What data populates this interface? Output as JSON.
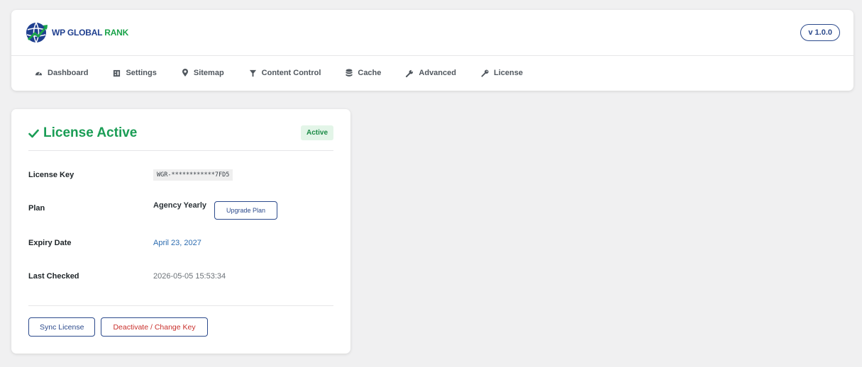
{
  "brand": {
    "name_part1": "WP GLOBAL",
    "name_part2": "RANK",
    "version": "v 1.0.0"
  },
  "nav": [
    {
      "label": "Dashboard",
      "icon": "dashboard-icon"
    },
    {
      "label": "Settings",
      "icon": "settings-icon"
    },
    {
      "label": "Sitemap",
      "icon": "map-pin-icon"
    },
    {
      "label": "Content Control",
      "icon": "filter-icon"
    },
    {
      "label": "Cache",
      "icon": "database-icon"
    },
    {
      "label": "Advanced",
      "icon": "wrench-icon"
    },
    {
      "label": "License",
      "icon": "key-icon"
    }
  ],
  "license": {
    "title": "License Active",
    "status": "Active",
    "rows": {
      "key_label": "License Key",
      "key_value": "WGR-************7FD5",
      "plan_label": "Plan",
      "plan_value": "Agency Yearly",
      "upgrade_label": "Upgrade Plan",
      "expiry_label": "Expiry Date",
      "expiry_value": "April 23, 2027",
      "checked_label": "Last Checked",
      "checked_value": "2026-05-05 15:53:34"
    },
    "actions": {
      "sync_label": "Sync License",
      "deactivate_label": "Deactivate / Change Key"
    }
  },
  "colors": {
    "accent": "#2c4a8c",
    "success": "#1a9d55",
    "danger": "#c9302c",
    "background": "#f0f0f1"
  }
}
